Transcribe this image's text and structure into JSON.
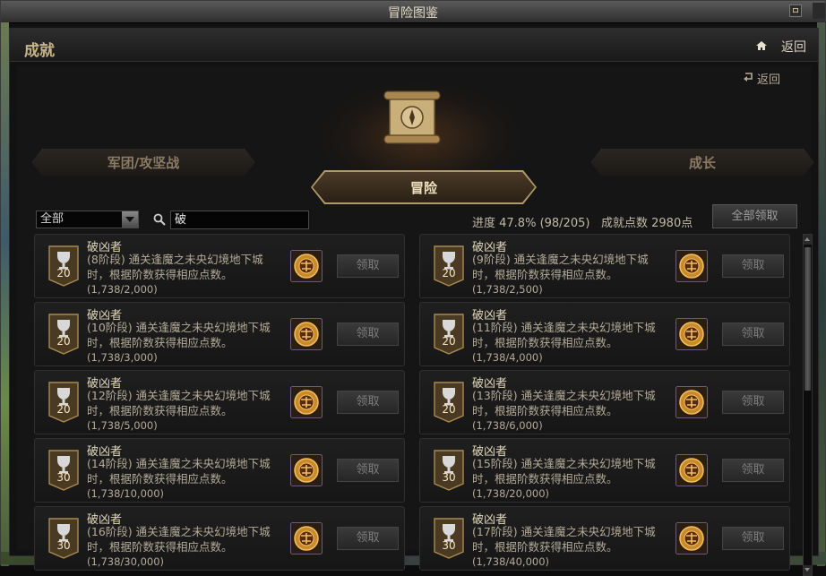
{
  "window": {
    "title": "冒险图鉴"
  },
  "header": {
    "title": "成就",
    "back_label": "返回"
  },
  "sub_back_label": "返回",
  "tabs": [
    {
      "label": "军团/攻坚战",
      "active": false
    },
    {
      "label": "冒险",
      "active": true
    },
    {
      "label": "成长",
      "active": false
    }
  ],
  "filter": {
    "selected": "全部"
  },
  "search": {
    "value": "破"
  },
  "stats": {
    "progress": "进度 47.8% (98/205)",
    "points": "成就点数 2980点"
  },
  "claim_all_label": "全部领取",
  "cards": [
    {
      "title": "破凶者",
      "points": "20",
      "desc": "(8阶段) 通关逢魔之未央幻境地下城时，根据阶数获得相应点数。",
      "progress": "(1,738/2,000)",
      "button": "领取"
    },
    {
      "title": "破凶者",
      "points": "20",
      "desc": "(9阶段) 通关逢魔之未央幻境地下城时，根据阶数获得相应点数。",
      "progress": "(1,738/2,500)",
      "button": "领取"
    },
    {
      "title": "破凶者",
      "points": "20",
      "desc": "(10阶段) 通关逢魔之未央幻境地下城时，根据阶数获得相应点数。",
      "progress": "(1,738/3,000)",
      "button": "领取"
    },
    {
      "title": "破凶者",
      "points": "20",
      "desc": "(11阶段) 通关逢魔之未央幻境地下城时，根据阶数获得相应点数。",
      "progress": "(1,738/4,000)",
      "button": "领取"
    },
    {
      "title": "破凶者",
      "points": "20",
      "desc": "(12阶段) 通关逢魔之未央幻境地下城时，根据阶数获得相应点数。",
      "progress": "(1,738/5,000)",
      "button": "领取"
    },
    {
      "title": "破凶者",
      "points": "20",
      "desc": "(13阶段) 通关逢魔之未央幻境地下城时，根据阶数获得相应点数。",
      "progress": "(1,738/6,000)",
      "button": "领取"
    },
    {
      "title": "破凶者",
      "points": "30",
      "desc": "(14阶段) 通关逢魔之未央幻境地下城时，根据阶数获得相应点数。",
      "progress": "(1,738/10,000)",
      "button": "领取"
    },
    {
      "title": "破凶者",
      "points": "30",
      "desc": "(15阶段) 通关逢魔之未央幻境地下城时，根据阶数获得相应点数。",
      "progress": "(1,738/20,000)",
      "button": "领取"
    },
    {
      "title": "破凶者",
      "points": "30",
      "desc": "(16阶段) 通关逢魔之未央幻境地下城时，根据阶数获得相应点数。",
      "progress": "(1,738/30,000)",
      "button": "领取"
    },
    {
      "title": "破凶者",
      "points": "30",
      "desc": "(17阶段) 通关逢魔之未央幻境地下城时，根据阶数获得相应点数。",
      "progress": "(1,738/40,000)",
      "button": "领取"
    }
  ]
}
